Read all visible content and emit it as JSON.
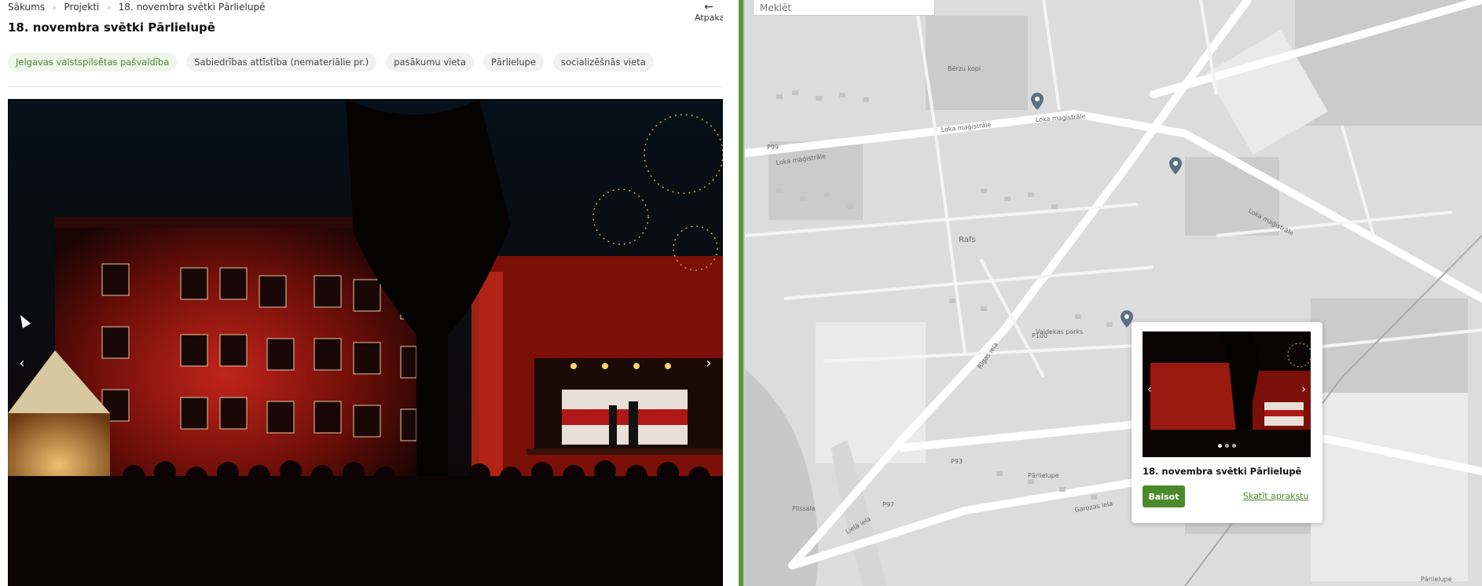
{
  "breadcrumb": {
    "home": "Sākums",
    "projects": "Projekti",
    "current": "18. novembra svētki Pārlielupē"
  },
  "back": {
    "label": "Atpakaļ",
    "icon": "arrow-left-icon"
  },
  "page": {
    "title": "18. novembra svētki Pārlielupē"
  },
  "tags": [
    {
      "label": "Jelgavas valstspilsētas pašvaldība",
      "highlight": true
    },
    {
      "label": "Sabiedrības attīstība (nemateriālie pr.)"
    },
    {
      "label": "pasākumu vieta"
    },
    {
      "label": "Pārlielupe"
    },
    {
      "label": "socializēšnās vieta"
    }
  ],
  "gallery": {
    "prev_icon": "chevron-left-icon",
    "next_icon": "chevron-right-icon"
  },
  "map": {
    "search_placeholder": "Meklēt",
    "labels": {
      "berzu_kopi": "Bērzu kopi",
      "loka_magistrale_1": "Loka maģistrāle",
      "loka_magistrale_2": "Loka maģistrāle",
      "loka_magistrale_3": "Loka maģistrāle",
      "loka_magistrale_4": "Loka maģistrāle",
      "p99": "P99",
      "p100": "P100",
      "p93": "P93",
      "p97": "P97",
      "rafs": "Rafs",
      "valdekas_parks": "Valdekas parks",
      "parlielupe": "Pārlielupe",
      "pilssala": "Pilssala",
      "rigas_iela": "Rīgas iela",
      "lielas_iela": "Lielā iela",
      "garozas_iela": "Garozas iela",
      "parlielupe_2": "Pārlielupe"
    }
  },
  "popup": {
    "title": "18. novembra svētki Pārlielupē",
    "vote_label": "Balsot",
    "details_label": "Skatīt aprakstu",
    "dots": 3,
    "active_dot": 0
  },
  "colors": {
    "accent": "#4a8a2a",
    "marker": "#5b6f85"
  }
}
